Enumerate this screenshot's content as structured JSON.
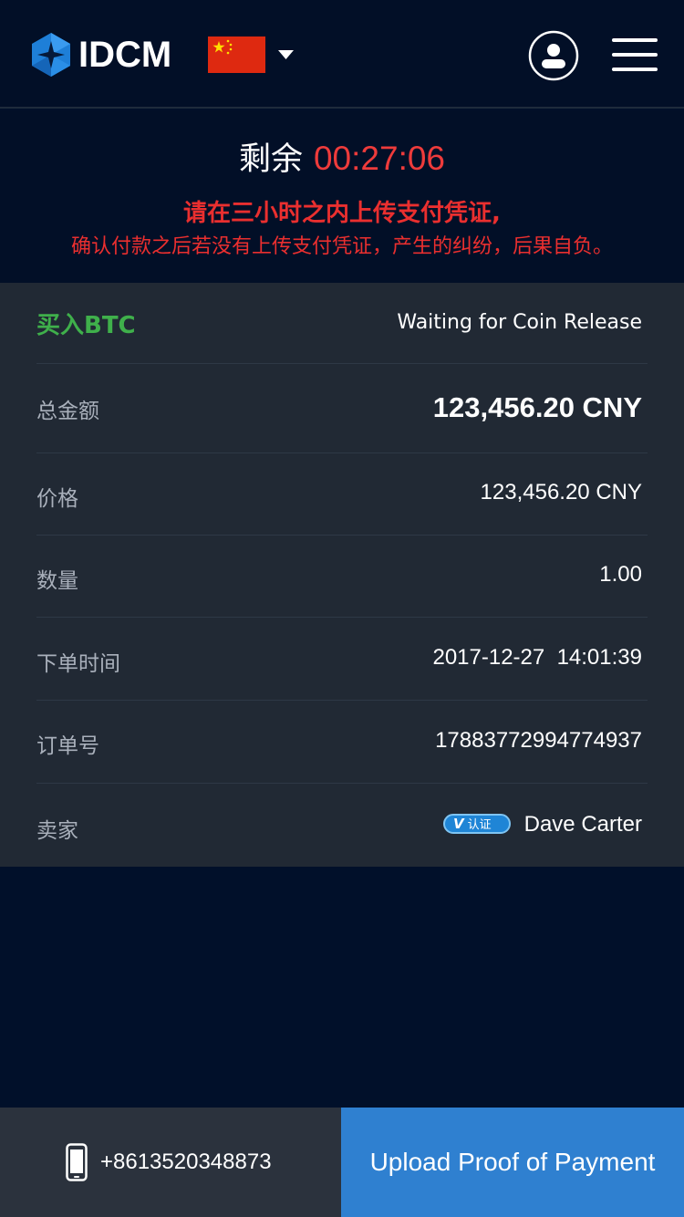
{
  "header": {
    "brand": "IDCM",
    "logo_icon": "idcm-hexagon-logo-icon",
    "flag_icon": "china-flag-icon",
    "user_icon": "user-account-icon",
    "menu_icon": "hamburger-menu-icon"
  },
  "countdown": {
    "label": "剩余",
    "time": "00:27:06",
    "warning_line1": "请在三小时之内上传支付凭证,",
    "warning_line2": "确认付款之后若没有上传支付凭证，产生的纠纷，后果自负。"
  },
  "order": {
    "type_label": "买入BTC",
    "status": "Waiting for Coin Release",
    "rows": [
      {
        "label": "总金额",
        "value": "123,456.20 CNY"
      },
      {
        "label": "价格",
        "value": "123,456.20 CNY"
      },
      {
        "label": "数量",
        "value": "1.00"
      },
      {
        "label": "下单时间",
        "value": "2017-12-27  14:01:39"
      },
      {
        "label": "订单号",
        "value": "17883772994774937"
      },
      {
        "label": "卖家",
        "value": "Dave Carter"
      }
    ],
    "verified_badge": "认证",
    "verified_mark": "V"
  },
  "footer": {
    "phone": "+8613520348873",
    "phone_icon": "mobile-phone-icon",
    "upload_label": "Upload Proof of Payment"
  },
  "colors": {
    "background": "#01102a",
    "card": "#212934",
    "accent_red": "#ea2f2f",
    "buy_green": "#3fb04b",
    "primary_blue": "#2f80d0"
  }
}
